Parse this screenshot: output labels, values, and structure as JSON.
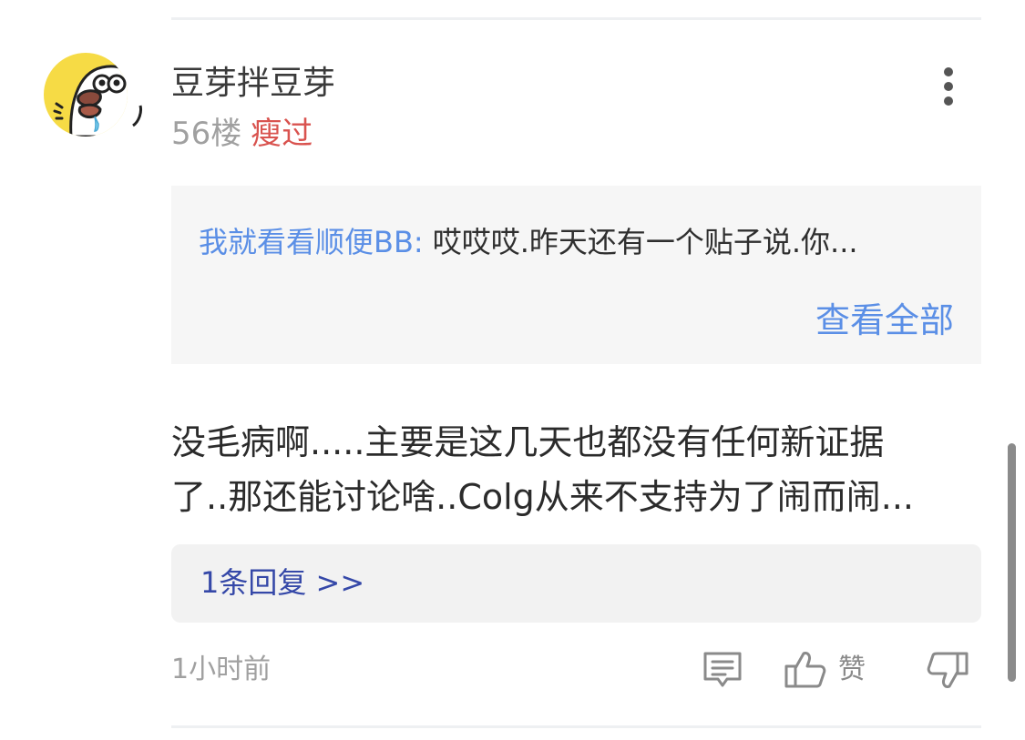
{
  "post": {
    "username": "豆芽拌豆芽",
    "floor": "56楼",
    "tag": "瘦过",
    "avatar_icon": "duck-avatar",
    "more_icon": "more-vertical-icon"
  },
  "quote": {
    "author": "我就看看顺便BB:",
    "text": "哎哎哎.昨天还有一个贴子说.你...",
    "view_all": "查看全部"
  },
  "comment": {
    "line1": "没毛病啊.....主要是这几天也都没有任何新证据",
    "line2": "了..那还能讨论啥..Colg从来不支持为了闹而闹..."
  },
  "reply": {
    "label": "1条回复 >>"
  },
  "footer": {
    "time": "1小时前",
    "like_label": "赞",
    "icons": [
      "comment-icon",
      "thumbs-up-icon",
      "thumbs-down-icon"
    ]
  },
  "colors": {
    "link_blue": "#5b8fe6",
    "reply_blue": "#3548a8",
    "tag_red": "#d9534f",
    "avatar_yellow": "#f6db45"
  }
}
